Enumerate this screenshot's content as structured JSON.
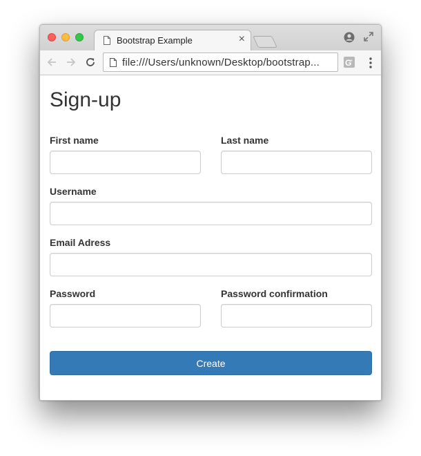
{
  "browser": {
    "tab_title": "Bootstrap Example",
    "tab_close_glyph": "×",
    "url": "file:///Users/unknown/Desktop/bootstrap...",
    "icons": [
      "document-icon",
      "profile-icon",
      "fullscreen-icon",
      "back-icon",
      "forward-icon",
      "reload-icon",
      "extension-icon",
      "menu-icon"
    ]
  },
  "form": {
    "title": "Sign-up",
    "first_name_label": "First name",
    "last_name_label": "Last name",
    "username_label": "Username",
    "email_label": "Email Adress",
    "password_label": "Password",
    "password_confirm_label": "Password confirmation",
    "first_name_value": "",
    "last_name_value": "",
    "username_value": "",
    "email_value": "",
    "password_value": "",
    "password_confirm_value": "",
    "submit_label": "Create"
  },
  "colors": {
    "primary": "#337ab7",
    "primary_border": "#2e6da4",
    "text": "#333333",
    "input_border": "#cccccc"
  }
}
